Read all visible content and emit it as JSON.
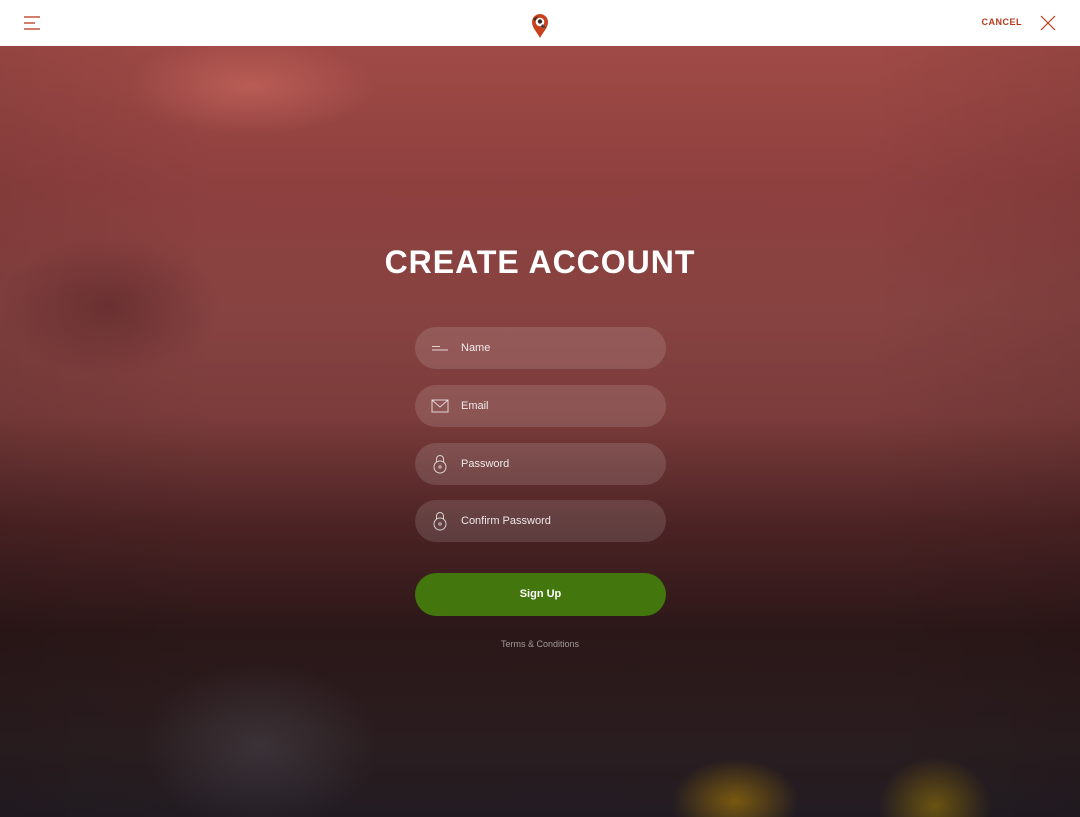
{
  "header": {
    "menu_icon": "hamburger-menu-icon",
    "logo_icon": "location-pin-bird-logo",
    "cancel_label": "CANCEL",
    "close_icon": "close-x-icon"
  },
  "form": {
    "title": "CREATE ACCOUNT",
    "fields": [
      {
        "id": "name",
        "placeholder": "Name",
        "value": "",
        "icon": "name-lines-icon"
      },
      {
        "id": "email",
        "placeholder": "Email",
        "value": "",
        "icon": "envelope-icon"
      },
      {
        "id": "password",
        "placeholder": "Password",
        "value": "",
        "icon": "padlock-icon"
      },
      {
        "id": "confirm_password",
        "placeholder": "Confirm Password",
        "value": "",
        "icon": "padlock-icon"
      }
    ],
    "submit_label": "Sign Up",
    "terms_label": "Terms & Conditions"
  },
  "colors": {
    "accent": "#b53a1c",
    "signup_button": "#43760c",
    "header_bg": "#ffffff"
  }
}
